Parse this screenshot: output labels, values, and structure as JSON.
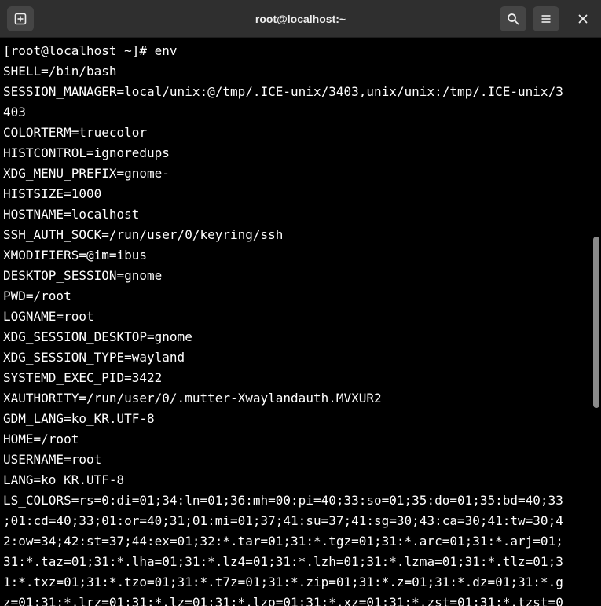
{
  "window": {
    "title": "root@localhost:~"
  },
  "toolbar": {
    "new_tab_icon": "new-tab-icon",
    "search_icon": "search-icon",
    "menu_icon": "hamburger-menu-icon",
    "close_icon": "close-icon"
  },
  "colors": {
    "titlebar": "#2f2f2f",
    "button": "#454545",
    "background": "#000000",
    "text": "#ffffff",
    "scroll_thumb": "#8a8a8a"
  },
  "terminal": {
    "lines": [
      "[root@localhost ~]# env",
      "SHELL=/bin/bash",
      "SESSION_MANAGER=local/unix:@/tmp/.ICE-unix/3403,unix/unix:/tmp/.ICE-unix/3",
      "403",
      "COLORTERM=truecolor",
      "HISTCONTROL=ignoredups",
      "XDG_MENU_PREFIX=gnome-",
      "HISTSIZE=1000",
      "HOSTNAME=localhost",
      "SSH_AUTH_SOCK=/run/user/0/keyring/ssh",
      "XMODIFIERS=@im=ibus",
      "DESKTOP_SESSION=gnome",
      "PWD=/root",
      "LOGNAME=root",
      "XDG_SESSION_DESKTOP=gnome",
      "XDG_SESSION_TYPE=wayland",
      "SYSTEMD_EXEC_PID=3422",
      "XAUTHORITY=/run/user/0/.mutter-Xwaylandauth.MVXUR2",
      "GDM_LANG=ko_KR.UTF-8",
      "HOME=/root",
      "USERNAME=root",
      "LANG=ko_KR.UTF-8",
      "LS_COLORS=rs=0:di=01;34:ln=01;36:mh=00:pi=40;33:so=01;35:do=01;35:bd=40;33",
      ";01:cd=40;33;01:or=40;31;01:mi=01;37;41:su=37;41:sg=30;43:ca=30;41:tw=30;4",
      "2:ow=34;42:st=37;44:ex=01;32:*.tar=01;31:*.tgz=01;31:*.arc=01;31:*.arj=01;",
      "31:*.taz=01;31:*.lha=01;31:*.lz4=01;31:*.lzh=01;31:*.lzma=01;31:*.tlz=01;3",
      "1:*.txz=01;31:*.tzo=01;31:*.t7z=01;31:*.zip=01;31:*.z=01;31:*.dz=01;31:*.g",
      "z=01;31:*.lrz=01;31:*.lz=01;31:*.lzo=01;31:*.xz=01;31:*.zst=01;31:*.tzst=0"
    ]
  }
}
